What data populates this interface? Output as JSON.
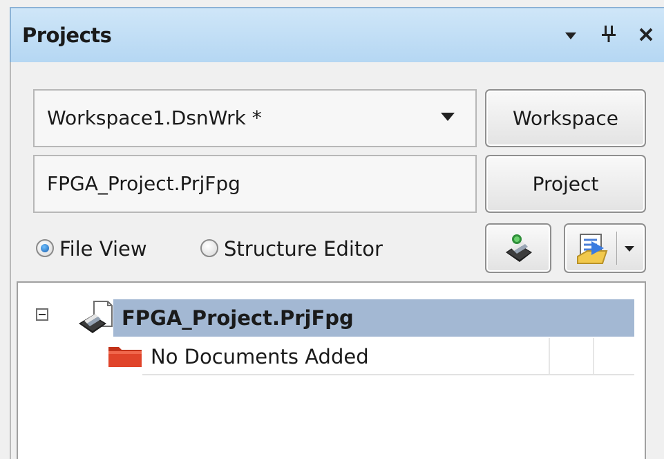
{
  "panel": {
    "title": "Projects",
    "menu_glyph": "▾",
    "pin_glyph": "⊥",
    "close_glyph": "×"
  },
  "workspace": {
    "current": "Workspace1.DsnWrk *",
    "button_label": "Workspace"
  },
  "project": {
    "current": "FPGA_Project.PrjFpg",
    "button_label": "Project"
  },
  "view_mode": {
    "options": [
      {
        "label": "File View",
        "selected": true
      },
      {
        "label": "Structure Editor",
        "selected": false
      }
    ]
  },
  "toolbar": {
    "icons": [
      "compile-project-icon",
      "project-documents-icon"
    ]
  },
  "tree": {
    "root": {
      "label": "FPGA_Project.PrjFpg",
      "expanded": true,
      "icon": "fpga-project-icon"
    },
    "children": [
      {
        "label": "No Documents Added",
        "icon": "folder-icon"
      }
    ]
  },
  "colors": {
    "titlebar": "#b5d7f3",
    "selection": "#a3b8d3",
    "folder": "#e0442a"
  }
}
